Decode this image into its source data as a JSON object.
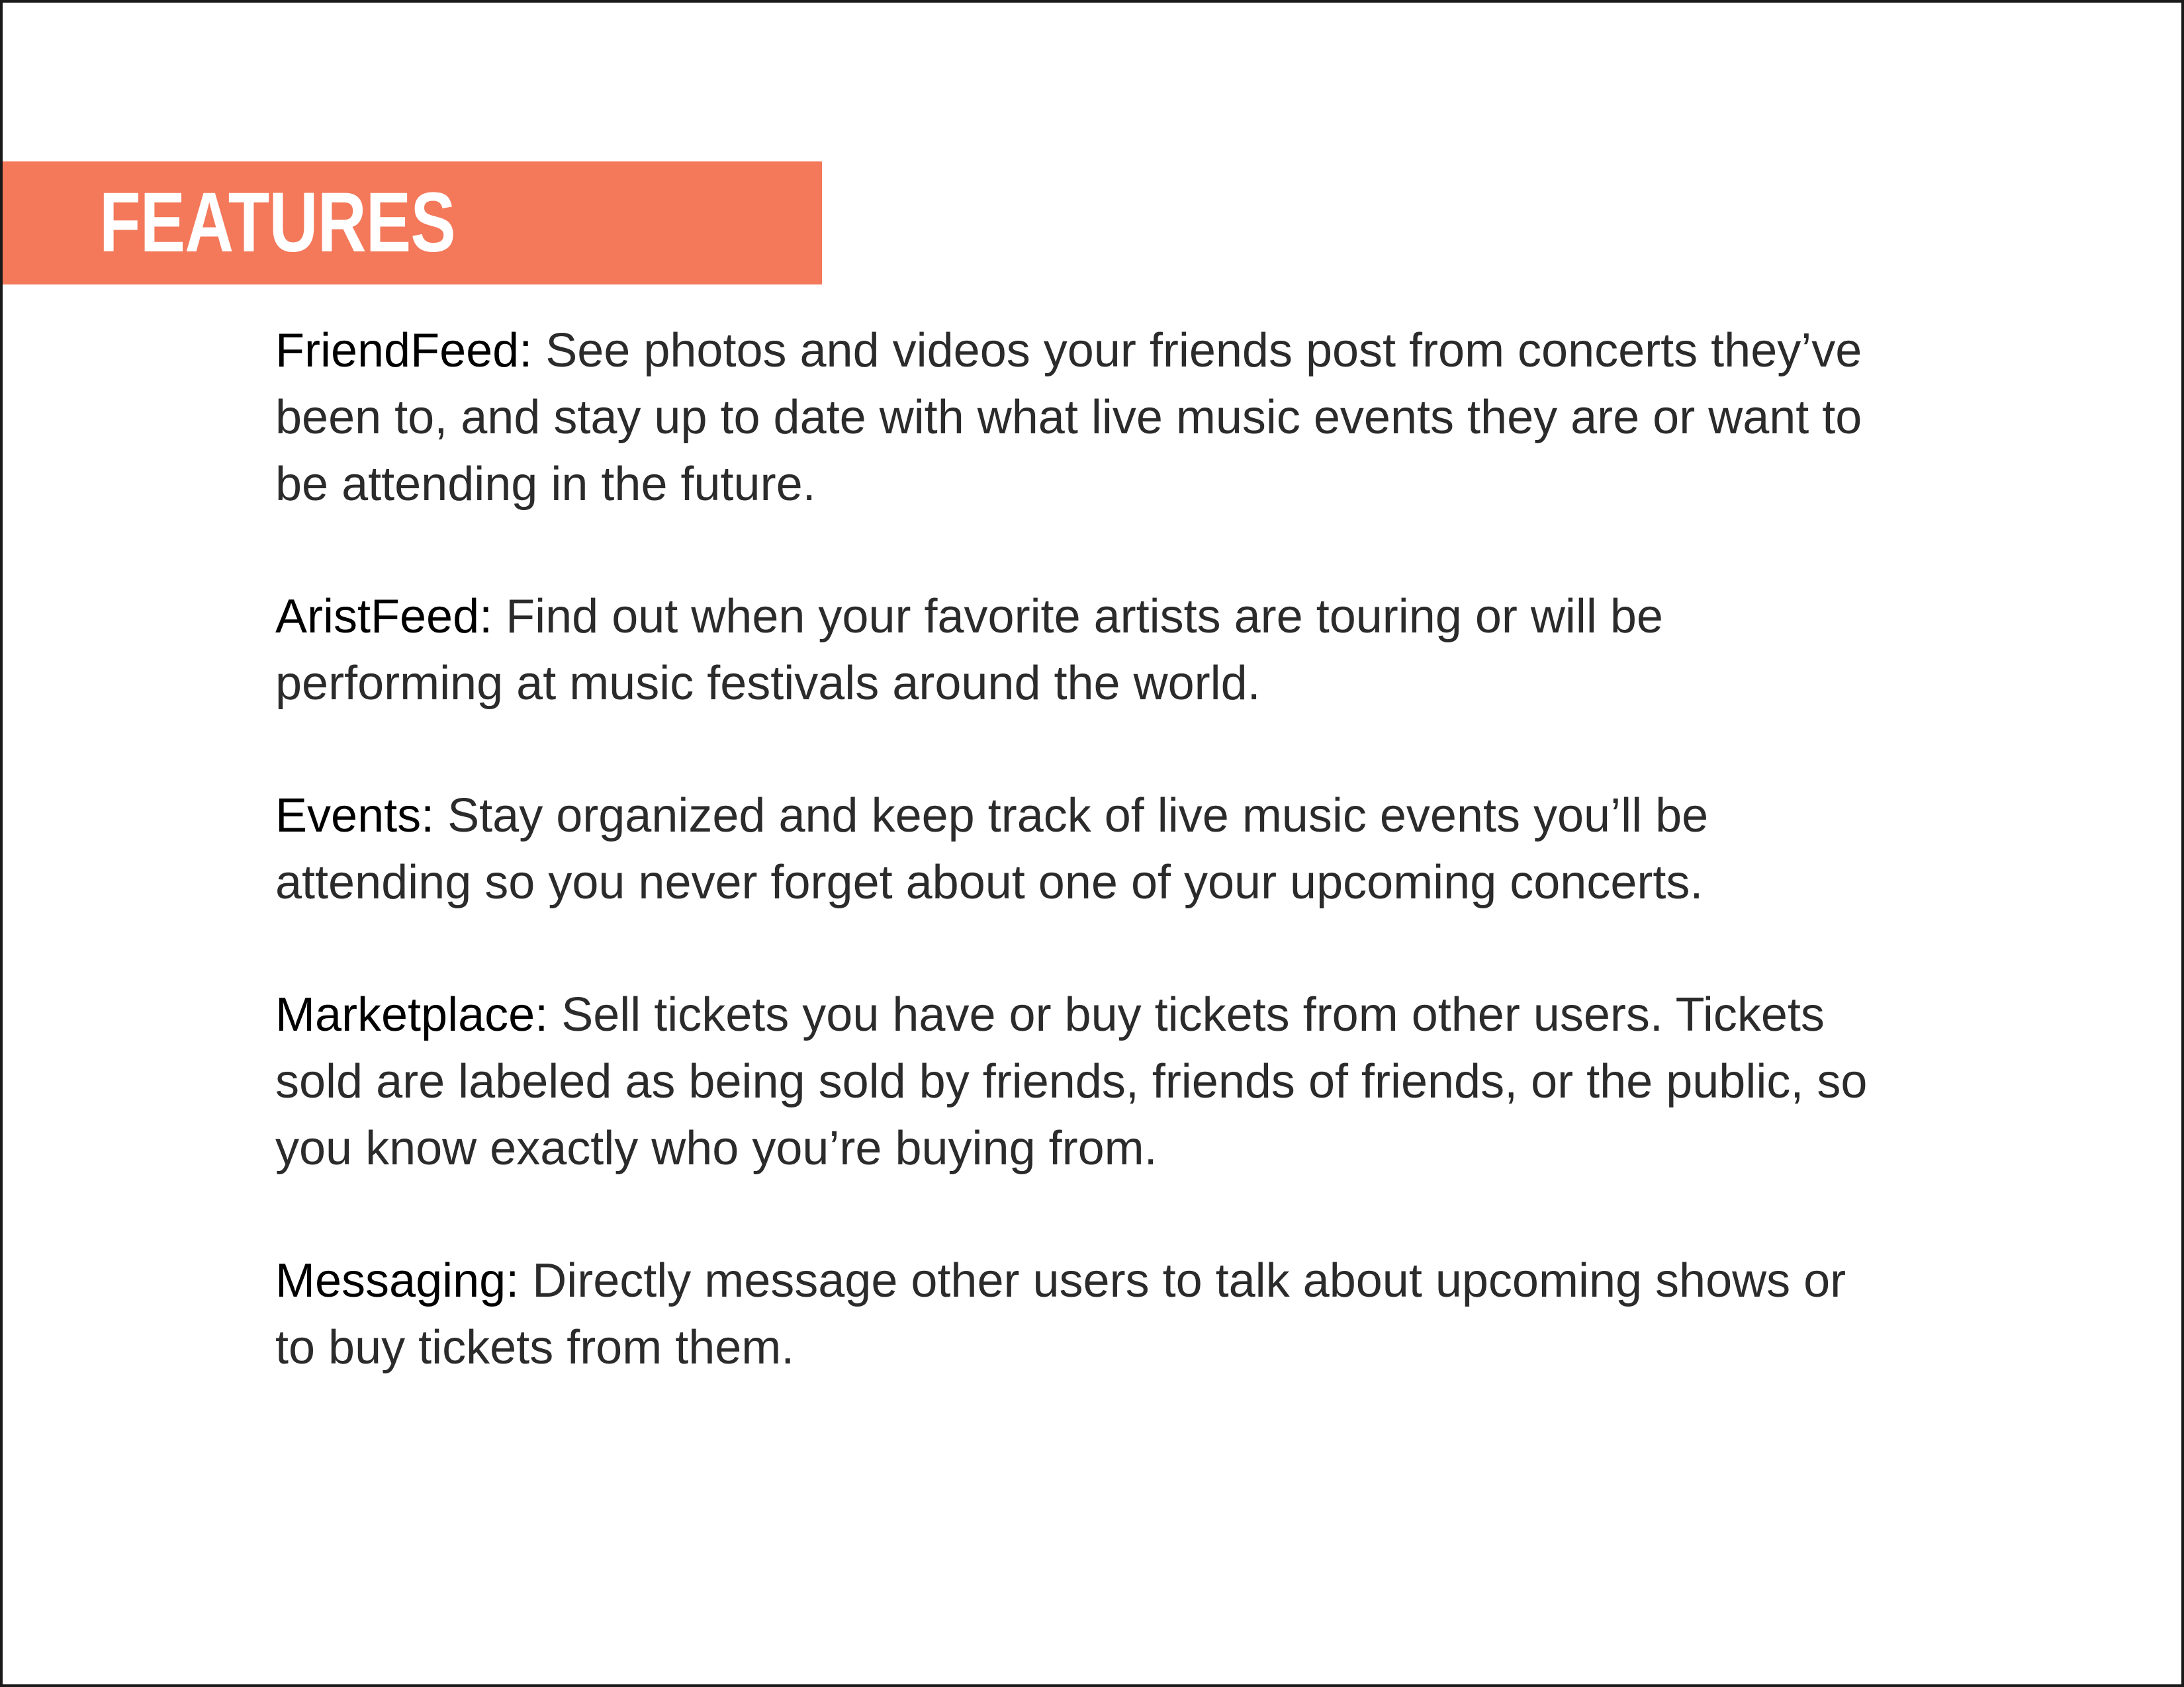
{
  "header": {
    "title": "FEATURES",
    "bar_color": "#f4785a"
  },
  "features": [
    {
      "name": "FriendFeed:",
      "description": "See photos and videos your friends post from concerts they’ve been to, and stay up to date with what live music events they are or want to be attending in the future."
    },
    {
      "name": "AristFeed:",
      "description": "Find out when your favorite artists are touring or will be performing at music festivals around the world."
    },
    {
      "name": "Events:",
      "description": "Stay organized and keep track of live music events you’ll be attending so you never forget about one of your upcoming concerts."
    },
    {
      "name": "Marketplace:",
      "description": "Sell tickets you have or buy tickets from other users. Tickets sold are labeled as being sold by friends, friends of friends, or the public, so you know exactly who you’re buying from."
    },
    {
      "name": "Messaging:",
      "description": "Directly message other users to talk about upcoming shows or to buy tickets from them."
    }
  ]
}
